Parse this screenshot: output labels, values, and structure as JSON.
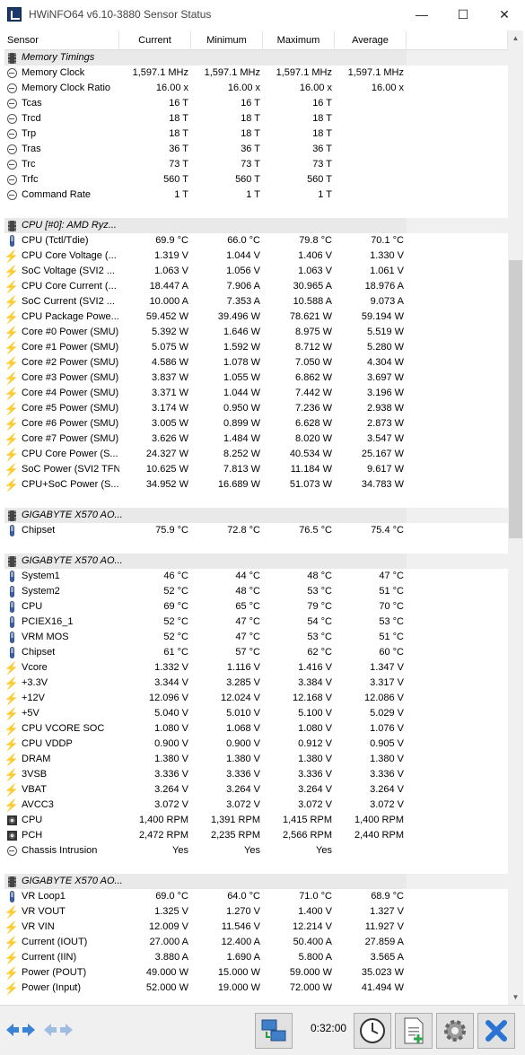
{
  "window": {
    "title": "HWiNFO64 v6.10-3880 Sensor Status",
    "minimize_symbol": "—",
    "maximize_symbol": "☐",
    "close_symbol": "✕"
  },
  "columns": [
    "Sensor",
    "Current",
    "Minimum",
    "Maximum",
    "Average"
  ],
  "rows": [
    {
      "kind": "group",
      "icon": "memory-chip-icon",
      "name": "Memory Timings"
    },
    {
      "kind": "data",
      "icon": "clock-icon",
      "name": "Memory Clock",
      "current": "1,597.1 MHz",
      "minimum": "1,597.1 MHz",
      "maximum": "1,597.1 MHz",
      "average": "1,597.1 MHz"
    },
    {
      "kind": "data",
      "icon": "clock-icon",
      "name": "Memory Clock Ratio",
      "current": "16.00 x",
      "minimum": "16.00 x",
      "maximum": "16.00 x",
      "average": "16.00 x"
    },
    {
      "kind": "data",
      "icon": "clock-icon",
      "name": "Tcas",
      "current": "16 T",
      "minimum": "16 T",
      "maximum": "16 T",
      "average": ""
    },
    {
      "kind": "data",
      "icon": "clock-icon",
      "name": "Trcd",
      "current": "18 T",
      "minimum": "18 T",
      "maximum": "18 T",
      "average": ""
    },
    {
      "kind": "data",
      "icon": "clock-icon",
      "name": "Trp",
      "current": "18 T",
      "minimum": "18 T",
      "maximum": "18 T",
      "average": ""
    },
    {
      "kind": "data",
      "icon": "clock-icon",
      "name": "Tras",
      "current": "36 T",
      "minimum": "36 T",
      "maximum": "36 T",
      "average": ""
    },
    {
      "kind": "data",
      "icon": "clock-icon",
      "name": "Trc",
      "current": "73 T",
      "minimum": "73 T",
      "maximum": "73 T",
      "average": ""
    },
    {
      "kind": "data",
      "icon": "clock-icon",
      "name": "Trfc",
      "current": "560 T",
      "minimum": "560 T",
      "maximum": "560 T",
      "average": ""
    },
    {
      "kind": "data",
      "icon": "clock-icon",
      "name": "Command Rate",
      "current": "1 T",
      "minimum": "1 T",
      "maximum": "1 T",
      "average": ""
    },
    {
      "kind": "blank"
    },
    {
      "kind": "group",
      "icon": "chip-icon",
      "name": "CPU [#0]: AMD Ryz..."
    },
    {
      "kind": "data",
      "icon": "thermometer-icon",
      "name": "CPU (Tctl/Tdie)",
      "current": "69.9 °C",
      "minimum": "66.0 °C",
      "maximum": "79.8 °C",
      "average": "70.1 °C"
    },
    {
      "kind": "data",
      "icon": "bolt-icon",
      "name": "CPU Core Voltage (...",
      "current": "1.319 V",
      "minimum": "1.044 V",
      "maximum": "1.406 V",
      "average": "1.330 V"
    },
    {
      "kind": "data",
      "icon": "bolt-icon",
      "name": "SoC Voltage (SVI2 ...",
      "current": "1.063 V",
      "minimum": "1.056 V",
      "maximum": "1.063 V",
      "average": "1.061 V"
    },
    {
      "kind": "data",
      "icon": "bolt-icon",
      "name": "CPU Core Current (...",
      "current": "18.447 A",
      "minimum": "7.906 A",
      "maximum": "30.965 A",
      "average": "18.976 A"
    },
    {
      "kind": "data",
      "icon": "bolt-icon",
      "name": "SoC Current (SVI2 ...",
      "current": "10.000 A",
      "minimum": "7.353 A",
      "maximum": "10.588 A",
      "average": "9.073 A"
    },
    {
      "kind": "data",
      "icon": "bolt-icon",
      "name": "CPU Package Powe...",
      "current": "59.452 W",
      "minimum": "39.496 W",
      "maximum": "78.621 W",
      "average": "59.194 W"
    },
    {
      "kind": "data",
      "icon": "bolt-icon",
      "name": "Core #0 Power (SMU)",
      "current": "5.392 W",
      "minimum": "1.646 W",
      "maximum": "8.975 W",
      "average": "5.519 W"
    },
    {
      "kind": "data",
      "icon": "bolt-icon",
      "name": "Core #1 Power (SMU)",
      "current": "5.075 W",
      "minimum": "1.592 W",
      "maximum": "8.712 W",
      "average": "5.280 W"
    },
    {
      "kind": "data",
      "icon": "bolt-icon",
      "name": "Core #2 Power (SMU)",
      "current": "4.586 W",
      "minimum": "1.078 W",
      "maximum": "7.050 W",
      "average": "4.304 W"
    },
    {
      "kind": "data",
      "icon": "bolt-icon",
      "name": "Core #3 Power (SMU)",
      "current": "3.837 W",
      "minimum": "1.055 W",
      "maximum": "6.862 W",
      "average": "3.697 W"
    },
    {
      "kind": "data",
      "icon": "bolt-icon",
      "name": "Core #4 Power (SMU)",
      "current": "3.371 W",
      "minimum": "1.044 W",
      "maximum": "7.442 W",
      "average": "3.196 W"
    },
    {
      "kind": "data",
      "icon": "bolt-icon",
      "name": "Core #5 Power (SMU)",
      "current": "3.174 W",
      "minimum": "0.950 W",
      "maximum": "7.236 W",
      "average": "2.938 W"
    },
    {
      "kind": "data",
      "icon": "bolt-icon",
      "name": "Core #6 Power (SMU)",
      "current": "3.005 W",
      "minimum": "0.899 W",
      "maximum": "6.628 W",
      "average": "2.873 W"
    },
    {
      "kind": "data",
      "icon": "bolt-icon",
      "name": "Core #7 Power (SMU)",
      "current": "3.626 W",
      "minimum": "1.484 W",
      "maximum": "8.020 W",
      "average": "3.547 W"
    },
    {
      "kind": "data",
      "icon": "bolt-icon",
      "name": "CPU Core Power (S...",
      "current": "24.327 W",
      "minimum": "8.252 W",
      "maximum": "40.534 W",
      "average": "25.167 W"
    },
    {
      "kind": "data",
      "icon": "bolt-icon",
      "name": "SoC Power (SVI2 TFN)",
      "current": "10.625 W",
      "minimum": "7.813 W",
      "maximum": "11.184 W",
      "average": "9.617 W"
    },
    {
      "kind": "data",
      "icon": "bolt-icon",
      "name": "CPU+SoC Power (S...",
      "current": "34.952 W",
      "minimum": "16.689 W",
      "maximum": "51.073 W",
      "average": "34.783 W"
    },
    {
      "kind": "blank"
    },
    {
      "kind": "group",
      "icon": "chip-icon",
      "name": "GIGABYTE X570 AO..."
    },
    {
      "kind": "data",
      "icon": "thermometer-icon",
      "name": "Chipset",
      "current": "75.9 °C",
      "minimum": "72.8 °C",
      "maximum": "76.5 °C",
      "average": "75.4 °C"
    },
    {
      "kind": "blank"
    },
    {
      "kind": "group",
      "icon": "chip-icon",
      "name": "GIGABYTE X570 AO..."
    },
    {
      "kind": "data",
      "icon": "thermometer-icon",
      "name": "System1",
      "current": "46 °C",
      "minimum": "44 °C",
      "maximum": "48 °C",
      "average": "47 °C"
    },
    {
      "kind": "data",
      "icon": "thermometer-icon",
      "name": "System2",
      "current": "52 °C",
      "minimum": "48 °C",
      "maximum": "53 °C",
      "average": "51 °C"
    },
    {
      "kind": "data",
      "icon": "thermometer-icon",
      "name": "CPU",
      "current": "69 °C",
      "minimum": "65 °C",
      "maximum": "79 °C",
      "average": "70 °C"
    },
    {
      "kind": "data",
      "icon": "thermometer-icon",
      "name": "PCIEX16_1",
      "current": "52 °C",
      "minimum": "47 °C",
      "maximum": "54 °C",
      "average": "53 °C"
    },
    {
      "kind": "data",
      "icon": "thermometer-icon",
      "name": "VRM MOS",
      "current": "52 °C",
      "minimum": "47 °C",
      "maximum": "53 °C",
      "average": "51 °C"
    },
    {
      "kind": "data",
      "icon": "thermometer-icon",
      "name": "Chipset",
      "current": "61 °C",
      "minimum": "57 °C",
      "maximum": "62 °C",
      "average": "60 °C"
    },
    {
      "kind": "data",
      "icon": "bolt-icon",
      "name": "Vcore",
      "current": "1.332 V",
      "minimum": "1.116 V",
      "maximum": "1.416 V",
      "average": "1.347 V"
    },
    {
      "kind": "data",
      "icon": "bolt-icon",
      "name": "+3.3V",
      "current": "3.344 V",
      "minimum": "3.285 V",
      "maximum": "3.384 V",
      "average": "3.317 V"
    },
    {
      "kind": "data",
      "icon": "bolt-icon",
      "name": "+12V",
      "current": "12.096 V",
      "minimum": "12.024 V",
      "maximum": "12.168 V",
      "average": "12.086 V"
    },
    {
      "kind": "data",
      "icon": "bolt-icon",
      "name": "+5V",
      "current": "5.040 V",
      "minimum": "5.010 V",
      "maximum": "5.100 V",
      "average": "5.029 V"
    },
    {
      "kind": "data",
      "icon": "bolt-icon",
      "name": "CPU VCORE SOC",
      "current": "1.080 V",
      "minimum": "1.068 V",
      "maximum": "1.080 V",
      "average": "1.076 V"
    },
    {
      "kind": "data",
      "icon": "bolt-icon",
      "name": "CPU VDDP",
      "current": "0.900 V",
      "minimum": "0.900 V",
      "maximum": "0.912 V",
      "average": "0.905 V"
    },
    {
      "kind": "data",
      "icon": "bolt-icon",
      "name": "DRAM",
      "current": "1.380 V",
      "minimum": "1.380 V",
      "maximum": "1.380 V",
      "average": "1.380 V"
    },
    {
      "kind": "data",
      "icon": "bolt-icon",
      "name": "3VSB",
      "current": "3.336 V",
      "minimum": "3.336 V",
      "maximum": "3.336 V",
      "average": "3.336 V"
    },
    {
      "kind": "data",
      "icon": "bolt-icon",
      "name": "VBAT",
      "current": "3.264 V",
      "minimum": "3.264 V",
      "maximum": "3.264 V",
      "average": "3.264 V"
    },
    {
      "kind": "data",
      "icon": "bolt-icon",
      "name": "AVCC3",
      "current": "3.072 V",
      "minimum": "3.072 V",
      "maximum": "3.072 V",
      "average": "3.072 V"
    },
    {
      "kind": "data",
      "icon": "fan-icon",
      "name": "CPU",
      "current": "1,400 RPM",
      "minimum": "1,391 RPM",
      "maximum": "1,415 RPM",
      "average": "1,400 RPM"
    },
    {
      "kind": "data",
      "icon": "fan-icon",
      "name": "PCH",
      "current": "2,472 RPM",
      "minimum": "2,235 RPM",
      "maximum": "2,566 RPM",
      "average": "2,440 RPM"
    },
    {
      "kind": "data",
      "icon": "clock-icon",
      "name": "Chassis Intrusion",
      "current": "Yes",
      "minimum": "Yes",
      "maximum": "Yes",
      "average": ""
    },
    {
      "kind": "blank"
    },
    {
      "kind": "group",
      "icon": "chip-icon",
      "name": "GIGABYTE X570 AO..."
    },
    {
      "kind": "data",
      "icon": "thermometer-icon",
      "name": "VR Loop1",
      "current": "69.0 °C",
      "minimum": "64.0 °C",
      "maximum": "71.0 °C",
      "average": "68.9 °C"
    },
    {
      "kind": "data",
      "icon": "bolt-icon",
      "name": "VR VOUT",
      "current": "1.325 V",
      "minimum": "1.270 V",
      "maximum": "1.400 V",
      "average": "1.327 V"
    },
    {
      "kind": "data",
      "icon": "bolt-icon",
      "name": "VR VIN",
      "current": "12.009 V",
      "minimum": "11.546 V",
      "maximum": "12.214 V",
      "average": "11.927 V"
    },
    {
      "kind": "data",
      "icon": "bolt-icon",
      "name": "Current (IOUT)",
      "current": "27.000 A",
      "minimum": "12.400 A",
      "maximum": "50.400 A",
      "average": "27.859 A"
    },
    {
      "kind": "data",
      "icon": "bolt-icon",
      "name": "Current (IIN)",
      "current": "3.880 A",
      "minimum": "1.690 A",
      "maximum": "5.800 A",
      "average": "3.565 A"
    },
    {
      "kind": "data",
      "icon": "bolt-icon",
      "name": "Power (POUT)",
      "current": "49.000 W",
      "minimum": "15.000 W",
      "maximum": "59.000 W",
      "average": "35.023 W"
    },
    {
      "kind": "data",
      "icon": "bolt-icon",
      "name": "Power (Input)",
      "current": "52.000 W",
      "minimum": "19.000 W",
      "maximum": "72.000 W",
      "average": "41.494 W"
    }
  ],
  "scrollbar": {
    "up_symbol": "▲",
    "down_symbol": "▼"
  },
  "toolbar": {
    "elapsed_time": "0:32:00",
    "nav_left_symbol": "⇦",
    "nav_right_symbol": "⇨"
  },
  "colors": {
    "group_background": "#e9e9e9",
    "bolt_yellow": "#e8b400",
    "close_button_blue": "#2b74d4"
  }
}
